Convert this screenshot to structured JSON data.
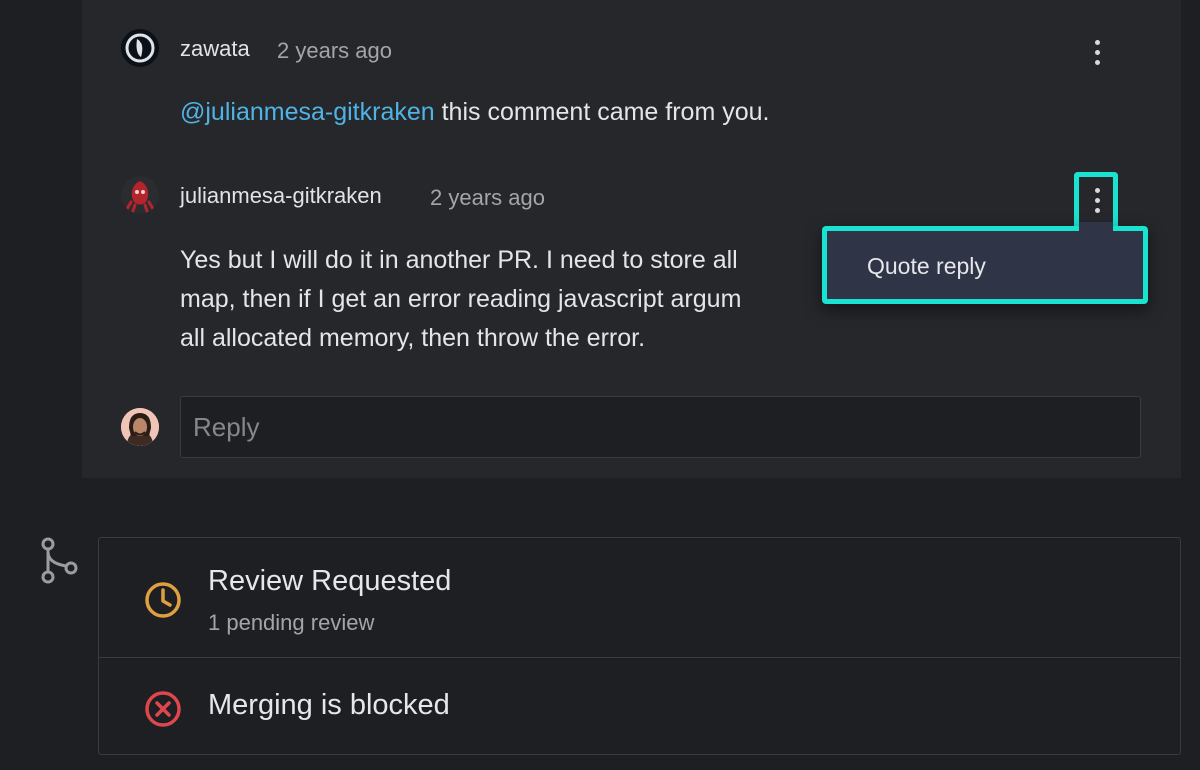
{
  "comments": [
    {
      "author": "zawata",
      "time": "2 years ago",
      "mention": "@julianmesa-gitkraken",
      "text": " this comment came from you."
    },
    {
      "author": "julianmesa-gitkraken",
      "time": "2 years ago",
      "lines": [
        "Yes but I will do it in another PR. I need to store all",
        "map, then if I get an error reading javascript argum",
        "all allocated memory, then throw the error."
      ]
    }
  ],
  "context_menu": {
    "items": [
      "Quote reply"
    ]
  },
  "reply": {
    "placeholder": "Reply"
  },
  "status": {
    "review": {
      "title": "Review Requested",
      "subtitle": "1 pending review"
    },
    "merge": {
      "title": "Merging is blocked"
    }
  },
  "colors": {
    "accent_highlight": "#19e3d0",
    "mention": "#4fb3e6",
    "pending": "#e0a040",
    "blocked": "#e0474c"
  },
  "icons": {
    "comment_menu": "kebab-icon",
    "timeline": "git-branch-icon",
    "review": "clock-icon",
    "merge": "x-circle-icon"
  }
}
